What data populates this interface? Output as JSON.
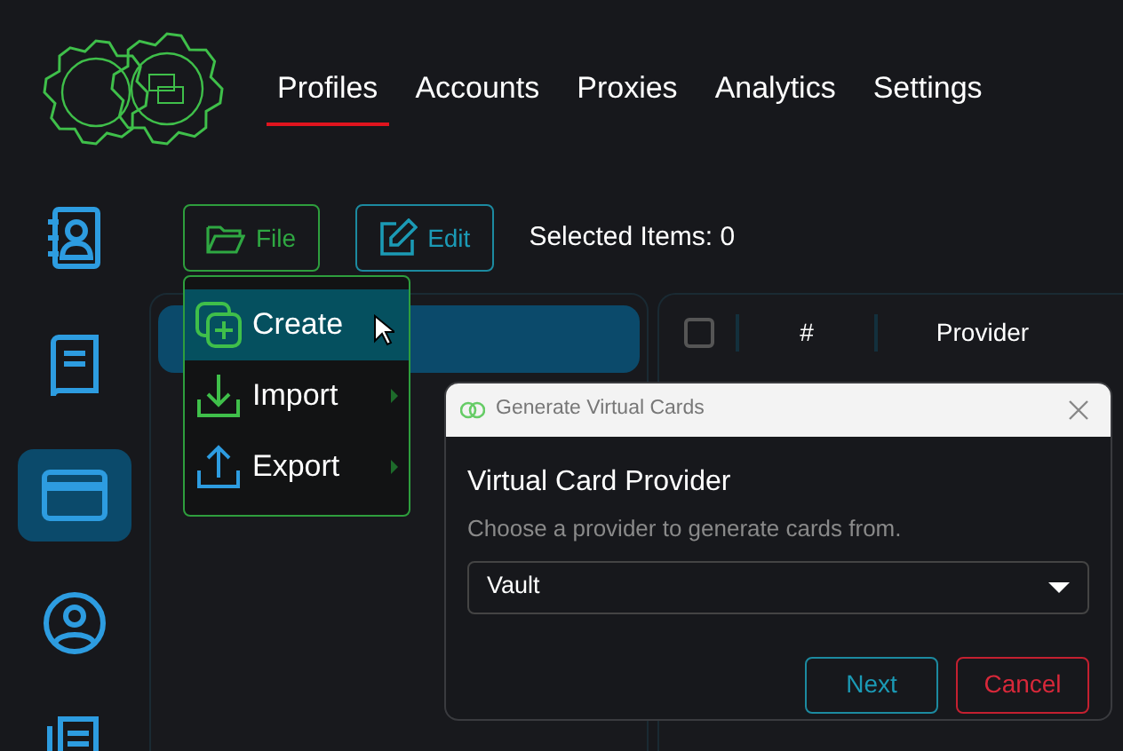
{
  "nav": {
    "tabs": [
      {
        "label": "Profiles",
        "selected": true
      },
      {
        "label": "Accounts",
        "selected": false
      },
      {
        "label": "Proxies",
        "selected": false
      },
      {
        "label": "Analytics",
        "selected": false
      },
      {
        "label": "Settings",
        "selected": false
      }
    ]
  },
  "sidebar": {
    "items": [
      {
        "selected": false
      },
      {
        "selected": false
      },
      {
        "selected": true
      },
      {
        "selected": false
      },
      {
        "selected": false
      }
    ]
  },
  "toolbar": {
    "buttons": [
      {
        "label": "File",
        "kind": "file"
      },
      {
        "label": "Edit",
        "kind": "edit"
      }
    ],
    "selected_count": "Selected Items: 0"
  },
  "profile_groups": [
    {
      "selected": true
    }
  ],
  "table": {
    "select_all_checked": false,
    "columns": [
      {
        "label": "#"
      },
      {
        "label": "Provider"
      }
    ]
  },
  "file_menu": {
    "items": [
      {
        "label": "Create",
        "selected": true,
        "submenu": false
      },
      {
        "label": "Import",
        "selected": false,
        "submenu": true
      },
      {
        "label": "Export",
        "selected": false,
        "submenu": true
      }
    ]
  },
  "dialog": {
    "title": "Generate Virtual Cards",
    "heading": "Virtual Card Provider",
    "description": "Choose a provider to generate cards from.",
    "provider_value": "Vault",
    "buttons": [
      {
        "label": "Next",
        "kind": "primary"
      },
      {
        "label": "Cancel",
        "kind": "danger"
      }
    ]
  }
}
